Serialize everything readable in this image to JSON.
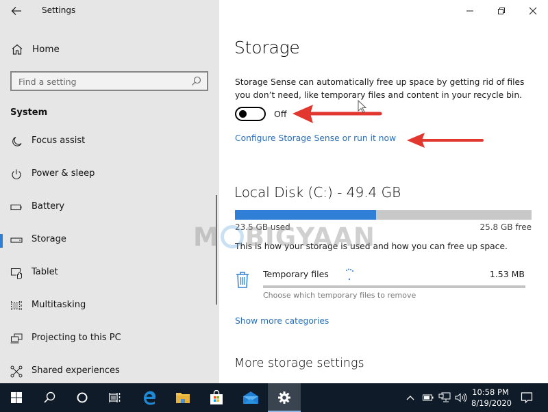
{
  "window": {
    "app_title": "Settings",
    "controls": {
      "minimize": "minimize-icon",
      "restore": "restore-icon",
      "close": "close-icon"
    }
  },
  "colors": {
    "accent": "#2f7fd6",
    "link": "#2a6eb5",
    "taskbar": "#0f1b29",
    "sidebar": "#e6e6e6",
    "annotation_arrow": "#e2372f"
  },
  "sidebar": {
    "home_label": "Home",
    "search": {
      "placeholder": "Find a setting",
      "value": ""
    },
    "section_title": "System",
    "items": [
      {
        "label": "Focus assist",
        "icon": "moon-icon",
        "active": false
      },
      {
        "label": "Power & sleep",
        "icon": "power-icon",
        "active": false
      },
      {
        "label": "Battery",
        "icon": "battery-icon",
        "active": false
      },
      {
        "label": "Storage",
        "icon": "storage-drive-icon",
        "active": true
      },
      {
        "label": "Tablet",
        "icon": "tablet-icon",
        "active": false
      },
      {
        "label": "Multitasking",
        "icon": "multitasking-icon",
        "active": false
      },
      {
        "label": "Projecting to this PC",
        "icon": "projecting-icon",
        "active": false
      },
      {
        "label": "Shared experiences",
        "icon": "shared-experiences-icon",
        "active": false
      }
    ]
  },
  "main": {
    "title": "Storage",
    "description": "Storage Sense can automatically free up space by getting rid of files you don’t need, like temporary files and content in your recycle bin.",
    "storage_sense_toggle": {
      "state": "Off",
      "on": false
    },
    "configure_link": "Configure Storage Sense or run it now",
    "disk": {
      "title": "Local Disk (C:) - 49.4 GB",
      "used_label": "23.5 GB used",
      "free_label": "25.8 GB free",
      "used_fraction": 0.476
    },
    "usage_hint": "This is how your storage is used and how you can free up space.",
    "categories": [
      {
        "name": "Temporary files",
        "size": "1.53 MB",
        "subtitle": "Choose which temporary files to remove",
        "fraction": 0.0,
        "loading": true,
        "icon": "trash-icon"
      }
    ],
    "show_more_link": "Show more categories",
    "more_settings_title": "More storage settings"
  },
  "overlay": {
    "watermark": "MOBIGYAAN",
    "arrows": [
      "arrow-pointing-to-toggle",
      "arrow-pointing-to-configure-link"
    ]
  },
  "taskbar": {
    "buttons": [
      {
        "name": "start-button",
        "icon": "windows-logo-icon"
      },
      {
        "name": "search-button",
        "icon": "search-icon"
      },
      {
        "name": "cortana-button",
        "icon": "cortana-circle-icon"
      },
      {
        "name": "task-view-button",
        "icon": "task-view-icon"
      },
      {
        "name": "edge-button",
        "icon": "edge-icon"
      },
      {
        "name": "file-explorer-button",
        "icon": "folder-icon"
      },
      {
        "name": "store-button",
        "icon": "store-bag-icon"
      },
      {
        "name": "mail-button",
        "icon": "mail-icon"
      },
      {
        "name": "settings-button",
        "icon": "gear-icon",
        "active": true
      }
    ],
    "tray": {
      "icons": [
        "chevron-up-icon",
        "battery-icon",
        "network-icon",
        "volume-icon"
      ],
      "time": "10:58 PM",
      "date": "8/19/2020",
      "notification_icon": "action-center-icon"
    }
  }
}
